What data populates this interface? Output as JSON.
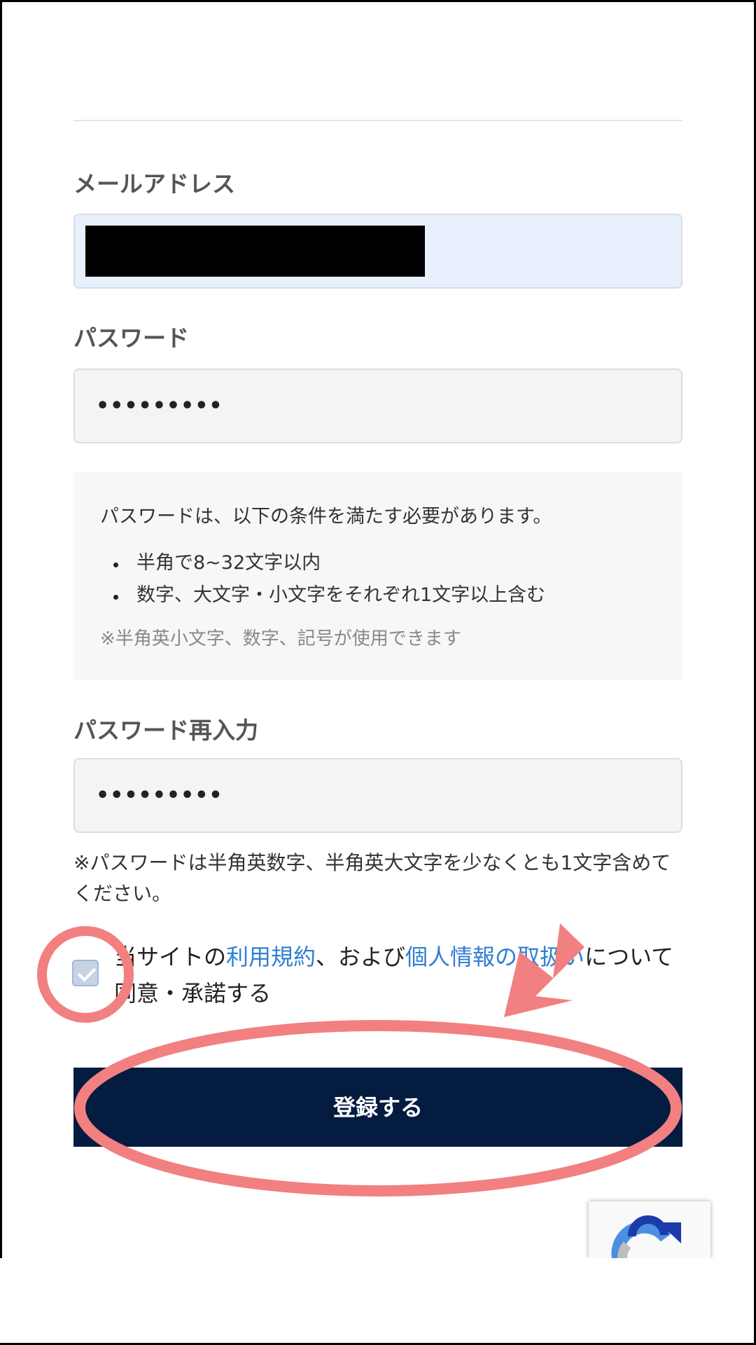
{
  "form": {
    "email_label": "メールアドレス",
    "password_label": "パスワード",
    "password_value": "•••••••••",
    "password_rules": {
      "intro": "パスワードは、以下の条件を満たす必要があります。",
      "items": [
        "半角で8~32文字以内",
        "数字、大文字・小文字をそれぞれ1文字以上含む"
      ],
      "note": "※半角英小文字、数字、記号が使用できます"
    },
    "confirm_label": "パスワード再入力",
    "confirm_value": "•••••••••",
    "password_notice": "※パスワードは半角英数字、半角英大文字を少なくとも1文字含めてください。",
    "consent": {
      "checked": true,
      "prefix": "当サイトの",
      "terms_link": "利用規約",
      "middle": "、および",
      "privacy_link": "個人情報の取扱い",
      "suffix": "について同意・承諾する"
    },
    "submit_label": "登録する"
  },
  "colors": {
    "submit_bg": "#041c3f",
    "link": "#2f7fd1",
    "autofill_bg": "#e8f0fe",
    "annotation": "#f28080"
  },
  "icons": {
    "checkbox_mark": "check-icon",
    "annotation_arrow": "arrow-icon",
    "recaptcha_badge": "recaptcha-icon"
  }
}
